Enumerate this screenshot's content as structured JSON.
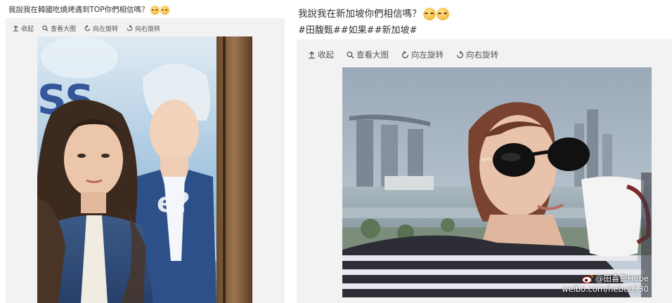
{
  "left_post": {
    "caption": "我說我在韓國吃燒烤遇到TOP你們相信嗎？",
    "emoji_count": 2,
    "toolbar": {
      "collapse": "收起",
      "view_large": "查看大图",
      "rotate_left": "向左旋转",
      "rotate_right": "向右旋转"
    },
    "photo": {
      "description_icon": "photo-selfie-with-poster"
    }
  },
  "right_post": {
    "caption": "我說我在新加坡你們相信嗎？",
    "emoji_count": 2,
    "hashtags": "#田馥甄##如果##新加坡#",
    "toolbar": {
      "collapse": "收起",
      "view_large": "查看大图",
      "rotate_left": "向左旋转",
      "rotate_right": "向右旋转"
    },
    "watermark": {
      "handle": "@田喜碧Hebe",
      "url": "weibo.com/hebe0330"
    }
  },
  "colors": {
    "card_bg": "#f2f2f2",
    "text": "#333333",
    "toolbar_text": "#555555",
    "emoji": "#f4b942"
  }
}
